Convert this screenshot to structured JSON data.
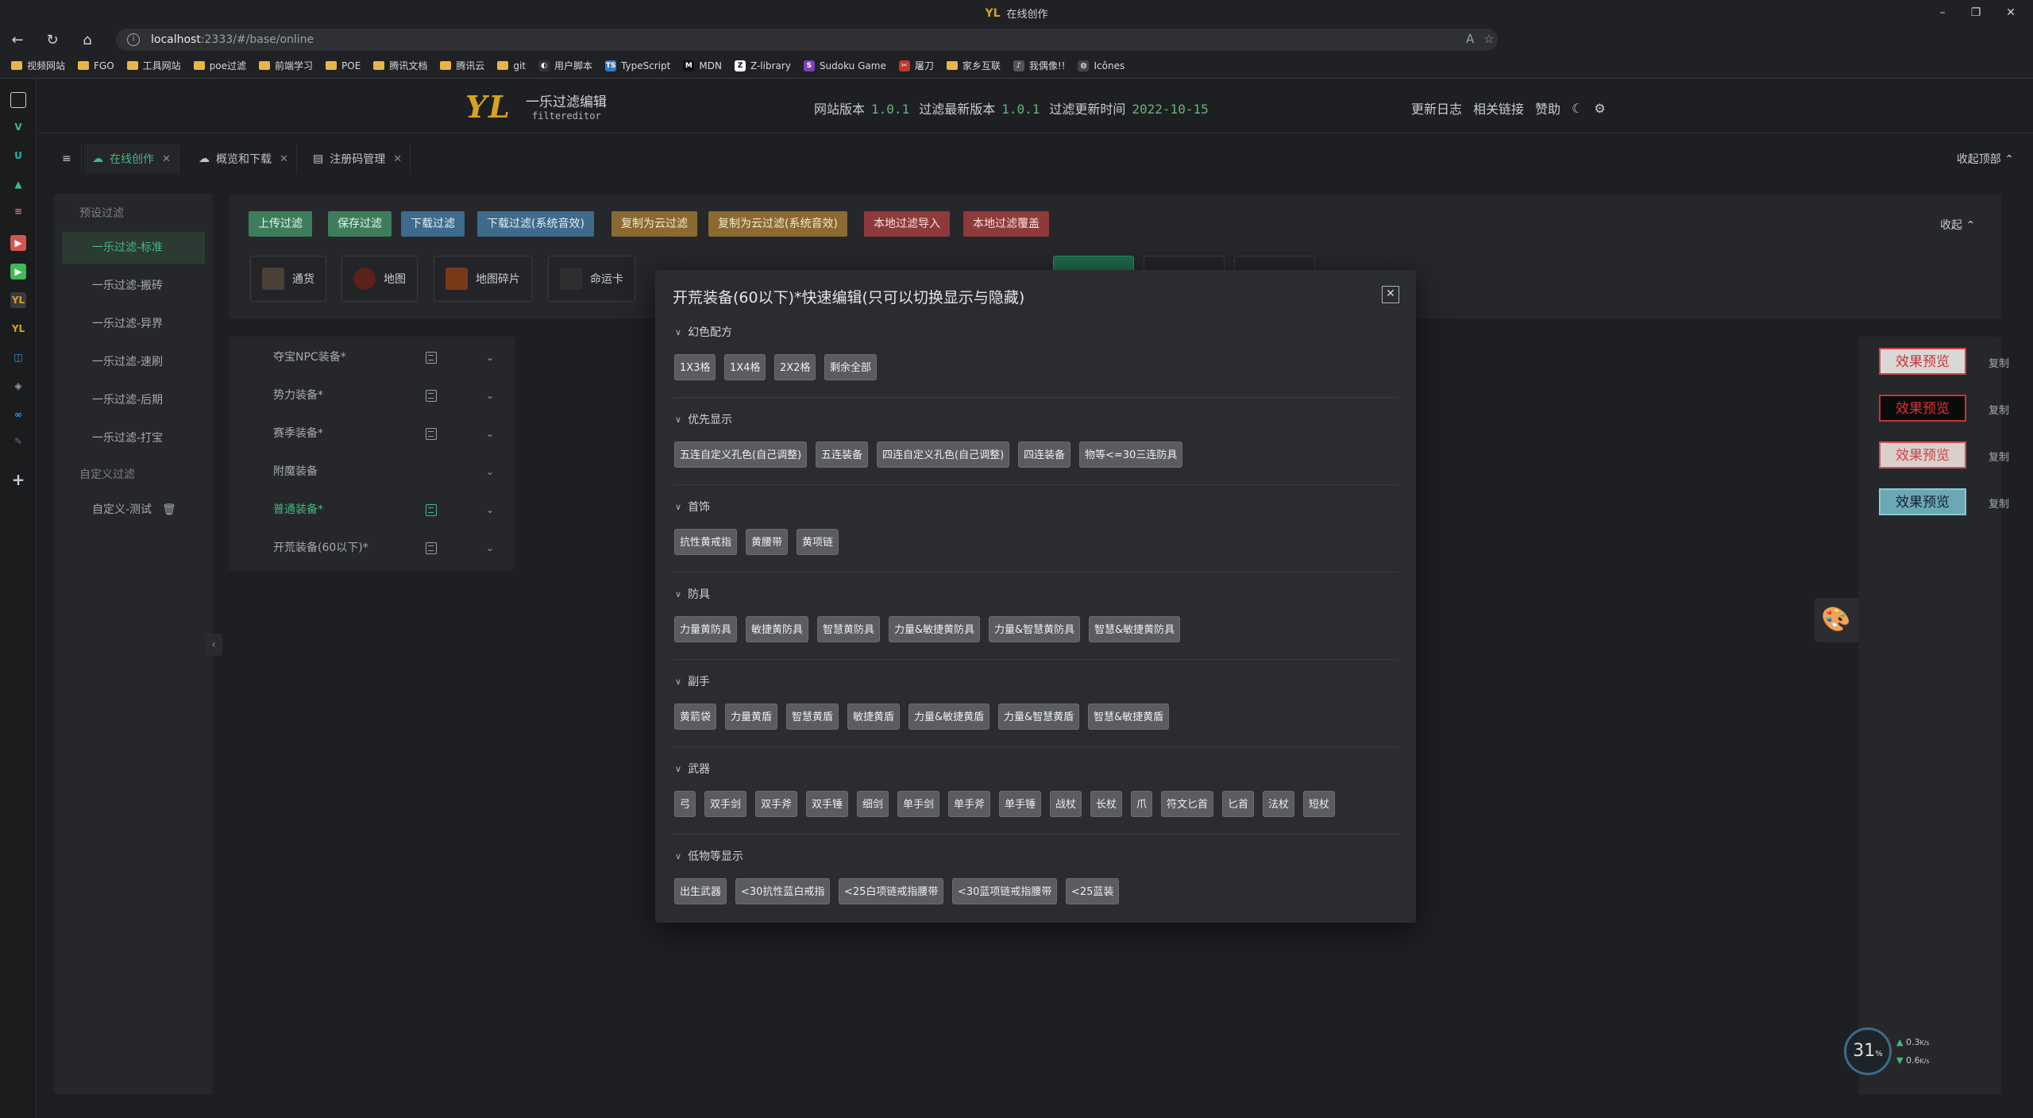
{
  "browser": {
    "window_title": "在线创作",
    "url_host": "localhost",
    "url_rest": ":2333/#/base/online",
    "bookmarks": [
      {
        "label": "视频网站",
        "icon": "folder"
      },
      {
        "label": "FGO",
        "icon": "folder"
      },
      {
        "label": "工具网站",
        "icon": "folder"
      },
      {
        "label": "poe过滤",
        "icon": "folder"
      },
      {
        "label": "前端学习",
        "icon": "folder"
      },
      {
        "label": "POE",
        "icon": "folder"
      },
      {
        "label": "腾讯文档",
        "icon": "folder"
      },
      {
        "label": "腾讯云",
        "icon": "folder"
      },
      {
        "label": "git",
        "icon": "folder"
      },
      {
        "label": "用户脚本",
        "icon": "userscript-icon"
      },
      {
        "label": "TypeScript",
        "icon": "ts-icon"
      },
      {
        "label": "MDN",
        "icon": "mdn-icon"
      },
      {
        "label": "Z-library",
        "icon": "zlib-icon"
      },
      {
        "label": "Sudoku Game",
        "icon": "sudoku-icon"
      },
      {
        "label": "屠刀",
        "icon": "blade-icon"
      },
      {
        "label": "家乡互联",
        "icon": "folder"
      },
      {
        "label": "我偶像!!",
        "icon": "idol-icon"
      },
      {
        "label": "Icônes",
        "icon": "icones-icon"
      }
    ]
  },
  "app": {
    "logo": "YL",
    "name": "一乐过滤编辑",
    "sub": "filtereditor",
    "version_label": "网站版本",
    "version": "1.0.1",
    "filter_version_label": "过滤最新版本",
    "filter_version": "1.0.1",
    "filter_update_label": "过滤更新时间",
    "filter_update": "2022-10-15",
    "header_links": [
      "更新日志",
      "相关链接",
      "赞助"
    ]
  },
  "tabs": [
    {
      "label": "在线创作",
      "icon": "cloud-icon"
    },
    {
      "label": "概览和下载",
      "icon": "cloud-download-icon"
    },
    {
      "label": "注册码管理",
      "icon": "key-icon"
    }
  ],
  "collapse_top": "收起顶部",
  "left_nav": {
    "preset_group": "预设过滤",
    "preset_items": [
      "一乐过滤-标准",
      "一乐过滤-搬砖",
      "一乐过滤-异界",
      "一乐过滤-速刷",
      "一乐过滤-后期",
      "一乐过滤-打宝"
    ],
    "custom_group": "自定义过滤",
    "custom_items": [
      "自定义-测试"
    ]
  },
  "toolbar": {
    "buttons": [
      "上传过滤",
      "保存过滤",
      "下载过滤",
      "下载过滤(系统音效)",
      "复制为云过滤",
      "复制为云过滤(系统音效)",
      "本地过滤导入",
      "本地过滤覆盖"
    ],
    "collapse": "收起",
    "categories": [
      "通货",
      "地图",
      "地图碎片",
      "命运卡"
    ]
  },
  "menu": {
    "items": [
      "夺宝NPC装备*",
      "势力装备*",
      "赛季装备*",
      "附魔装备",
      "普通装备*",
      "开荒装备(60以下)*"
    ]
  },
  "right": {
    "preview_label": "效果预览",
    "copy_label": "复制"
  },
  "net": {
    "percent": "31",
    "unit": "%",
    "up": "0.3",
    "down": "0.6",
    "speed_unit": "K/s"
  },
  "modal": {
    "title": "开荒装备(60以下)*快速编辑(只可以切换显示与隐藏)",
    "sections": [
      {
        "title": "幻色配方",
        "chips": [
          "1X3格",
          "1X4格",
          "2X2格",
          "剩余全部"
        ]
      },
      {
        "title": "优先显示",
        "chips": [
          "五连自定义孔色(自己调整)",
          "五连装备",
          "四连自定义孔色(自己调整)",
          "四连装备",
          "物等<=30三连防具"
        ]
      },
      {
        "title": "首饰",
        "chips": [
          "抗性黄戒指",
          "黄腰带",
          "黄项链"
        ]
      },
      {
        "title": "防具",
        "chips": [
          "力量黄防具",
          "敏捷黄防具",
          "智慧黄防具",
          "力量&敏捷黄防具",
          "力量&智慧黄防具",
          "智慧&敏捷黄防具"
        ]
      },
      {
        "title": "副手",
        "chips": [
          "黄箭袋",
          "力量黄盾",
          "智慧黄盾",
          "敏捷黄盾",
          "力量&敏捷黄盾",
          "力量&智慧黄盾",
          "智慧&敏捷黄盾"
        ]
      },
      {
        "title": "武器",
        "chips": [
          "弓",
          "双手剑",
          "双手斧",
          "双手锤",
          "细剑",
          "单手剑",
          "单手斧",
          "单手锤",
          "战杖",
          "长杖",
          "爪",
          "符文匕首",
          "匕首",
          "法杖",
          "短杖"
        ]
      },
      {
        "title": "低物等显示",
        "chips": [
          "出生武器",
          "<30抗性蓝白戒指",
          "<25白项链戒指腰带",
          "<30蓝项链戒指腰带",
          "<25蓝装"
        ]
      }
    ]
  }
}
